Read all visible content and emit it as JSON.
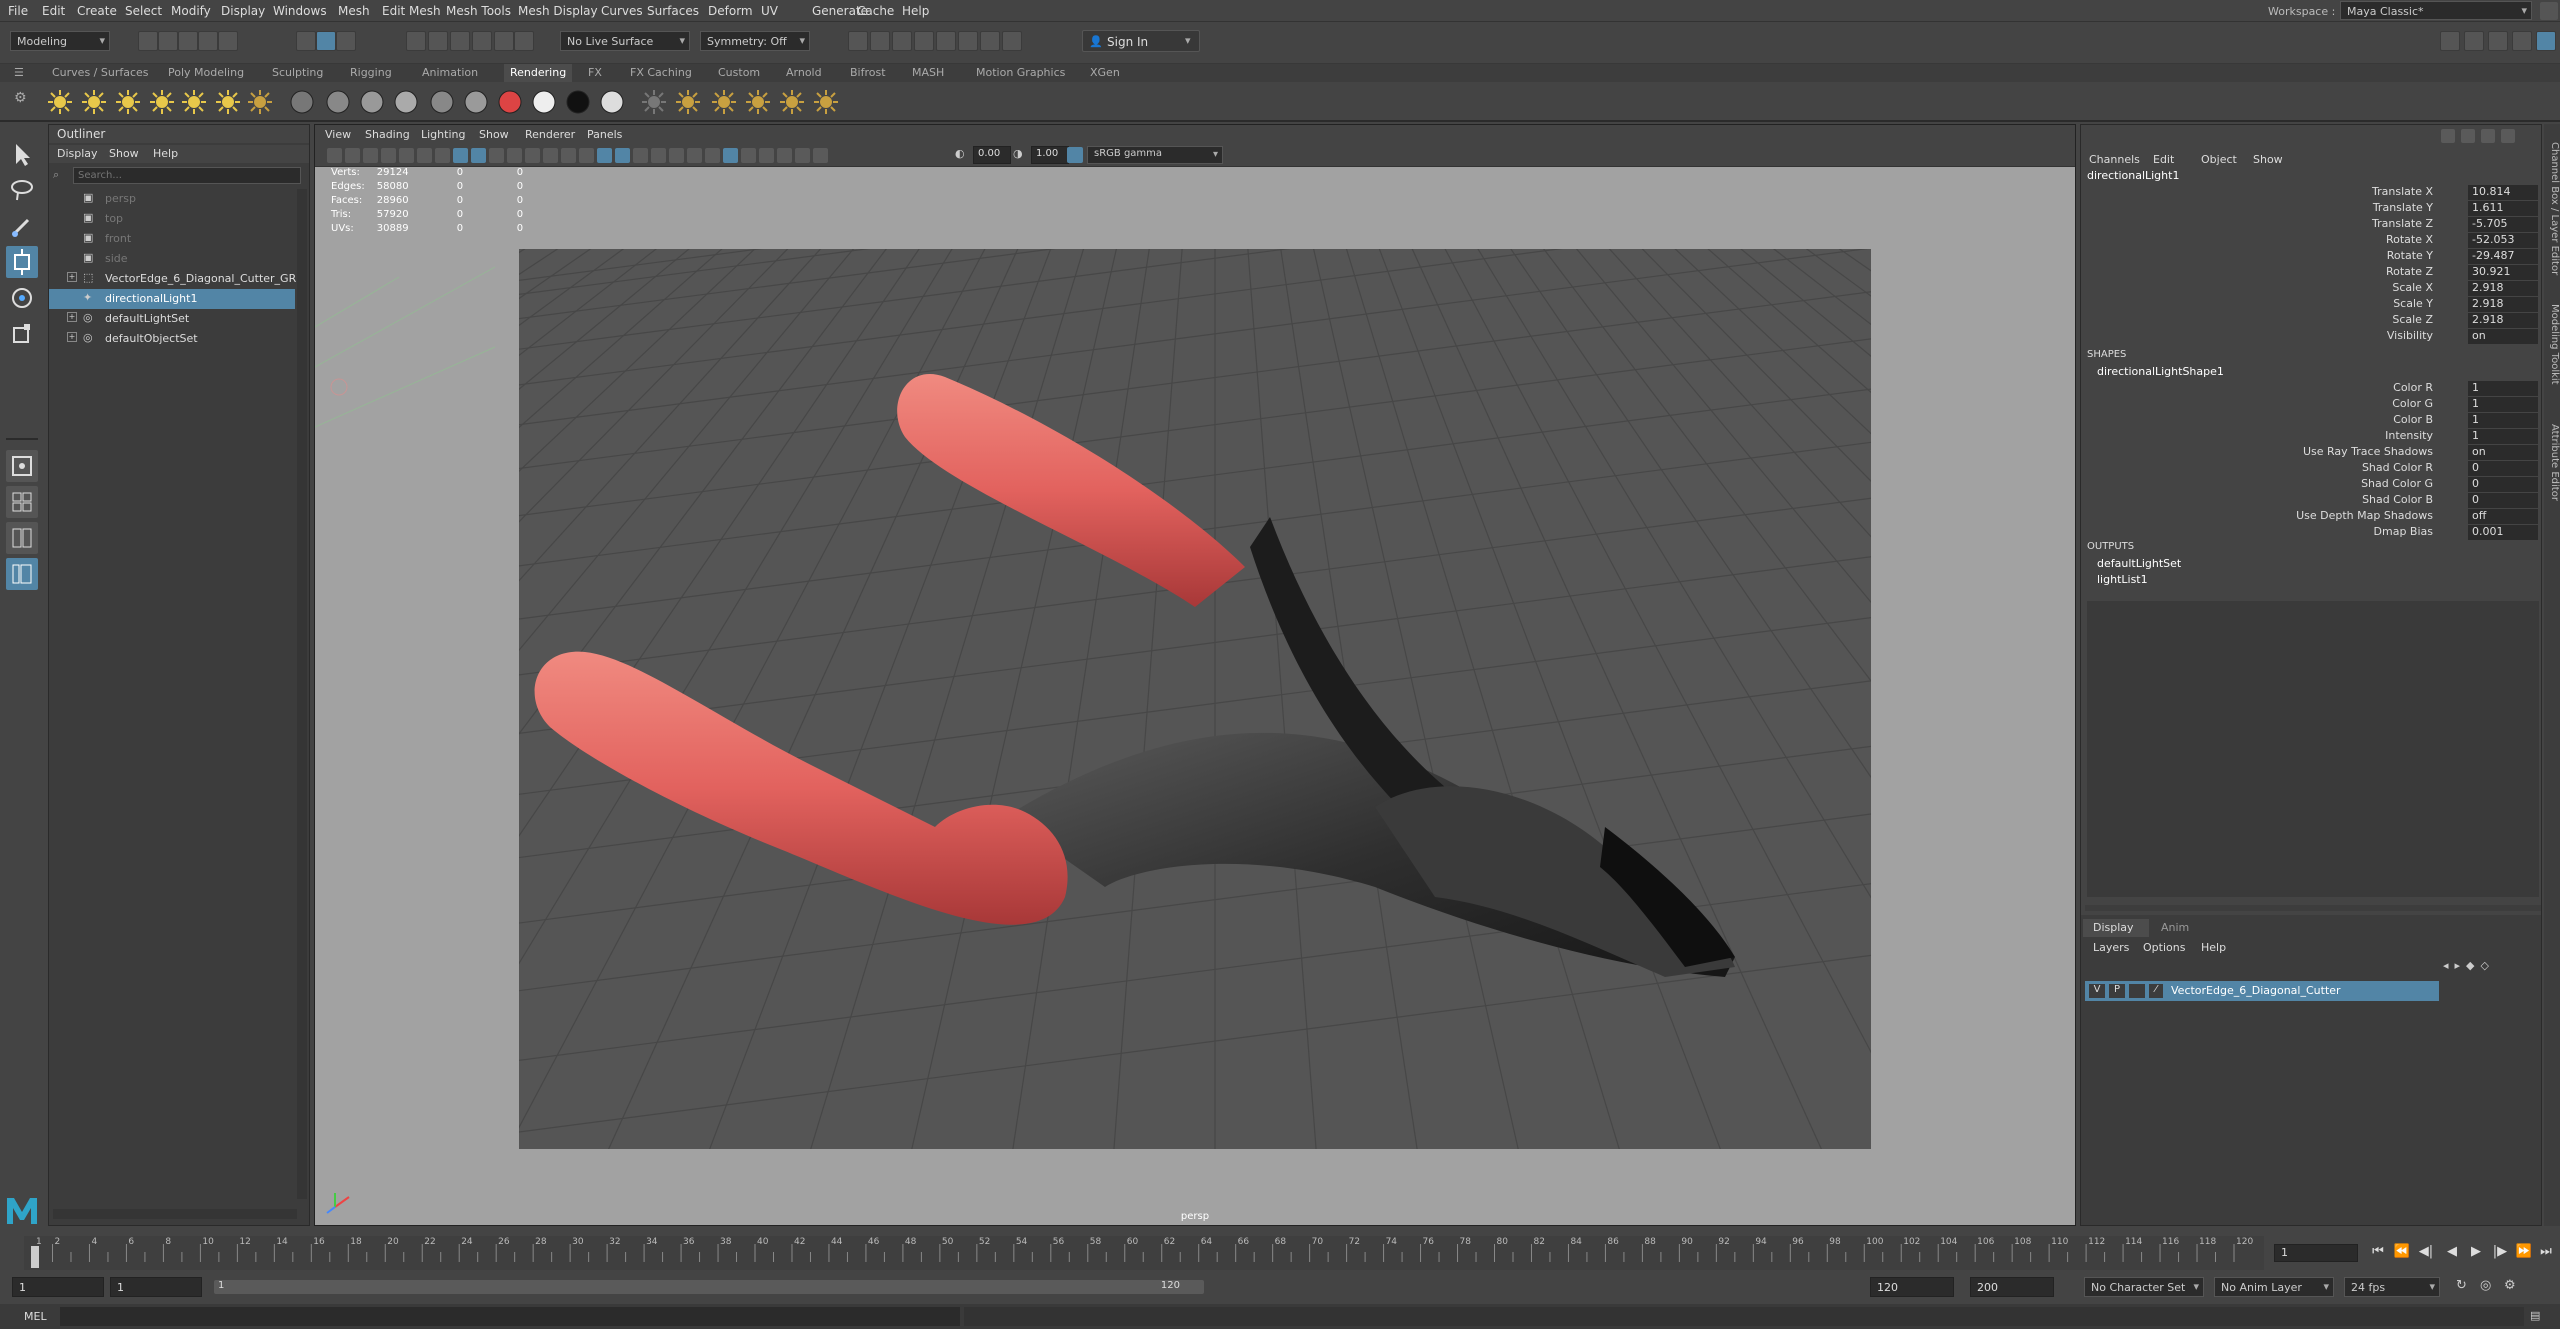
{
  "menubar": {
    "items": [
      "File",
      "Edit",
      "Create",
      "Select",
      "Modify",
      "Display",
      "Windows",
      "Mesh",
      "Edit Mesh",
      "Mesh Tools",
      "Mesh Display",
      "Curves",
      "Surfaces",
      "Deform",
      "UV",
      "Generate",
      "Cache",
      "Help"
    ],
    "workspace_label": "Workspace :",
    "workspace_value": "Maya Classic*"
  },
  "statusline": {
    "mode": "Modeling",
    "live_surface": "No Live Surface",
    "symmetry": "Symmetry: Off",
    "sign_in": "Sign In"
  },
  "shelf": {
    "tabs": [
      "Curves / Surfaces",
      "Poly Modeling",
      "Sculpting",
      "Rigging",
      "Animation",
      "Rendering",
      "FX",
      "FX Caching",
      "Custom",
      "Arnold",
      "Bifrost",
      "MASH",
      "Motion Graphics",
      "XGen"
    ],
    "active_tab": "Rendering"
  },
  "outliner": {
    "title": "Outliner",
    "menus": [
      "Display",
      "Show",
      "Help"
    ],
    "search_placeholder": "Search...",
    "items": [
      {
        "label": "persp",
        "icon": "camera-icon",
        "state": "dim"
      },
      {
        "label": "top",
        "icon": "camera-icon",
        "state": "dim"
      },
      {
        "label": "front",
        "icon": "camera-icon",
        "state": "dim"
      },
      {
        "label": "side",
        "icon": "camera-icon",
        "state": "dim"
      },
      {
        "label": "VectorEdge_6_Diagonal_Cutter_GRP",
        "icon": "group-icon",
        "state": "normal"
      },
      {
        "label": "directionalLight1",
        "icon": "directional-light-icon",
        "state": "selected"
      },
      {
        "label": "defaultLightSet",
        "icon": "set-icon",
        "state": "normal"
      },
      {
        "label": "defaultObjectSet",
        "icon": "set-icon",
        "state": "normal"
      }
    ]
  },
  "viewport": {
    "menus": [
      "View",
      "Shading",
      "Lighting",
      "Show",
      "Renderer",
      "Panels"
    ],
    "exposure": "0.00",
    "gamma": "1.00",
    "color_space": "sRGB gamma",
    "camera_label": "persp",
    "hud": [
      {
        "label": "Verts:",
        "a": "29124",
        "b": "0",
        "c": "0"
      },
      {
        "label": "Edges:",
        "a": "58080",
        "b": "0",
        "c": "0"
      },
      {
        "label": "Faces:",
        "a": "28960",
        "b": "0",
        "c": "0"
      },
      {
        "label": "Tris:",
        "a": "57920",
        "b": "0",
        "c": "0"
      },
      {
        "label": "UVs:",
        "a": "30889",
        "b": "0",
        "c": "0"
      }
    ]
  },
  "channelbox": {
    "menus": [
      "Channels",
      "Edit",
      "Object",
      "Show"
    ],
    "node": "directionalLight1",
    "channels": [
      {
        "name": "Translate X",
        "value": "10.814"
      },
      {
        "name": "Translate Y",
        "value": "1.611"
      },
      {
        "name": "Translate Z",
        "value": "-5.705"
      },
      {
        "name": "Rotate X",
        "value": "-52.053"
      },
      {
        "name": "Rotate Y",
        "value": "-29.487"
      },
      {
        "name": "Rotate Z",
        "value": "30.921"
      },
      {
        "name": "Scale X",
        "value": "2.918"
      },
      {
        "name": "Scale Y",
        "value": "2.918"
      },
      {
        "name": "Scale Z",
        "value": "2.918"
      },
      {
        "name": "Visibility",
        "value": "on"
      }
    ],
    "shapes_header": "SHAPES",
    "shape_node": "directionalLightShape1",
    "shape_channels": [
      {
        "name": "Color R",
        "value": "1"
      },
      {
        "name": "Color G",
        "value": "1"
      },
      {
        "name": "Color B",
        "value": "1"
      },
      {
        "name": "Intensity",
        "value": "1"
      },
      {
        "name": "Use Ray Trace Shadows",
        "value": "on"
      },
      {
        "name": "Shad Color R",
        "value": "0"
      },
      {
        "name": "Shad Color G",
        "value": "0"
      },
      {
        "name": "Shad Color B",
        "value": "0"
      },
      {
        "name": "Use Depth Map Shadows",
        "value": "off"
      },
      {
        "name": "Dmap Bias",
        "value": "0.001"
      }
    ],
    "outputs_header": "OUTPUTS",
    "outputs": [
      "defaultLightSet",
      "lightList1"
    ]
  },
  "layers": {
    "tabs": [
      "Display",
      "Anim"
    ],
    "menus": [
      "Layers",
      "Options",
      "Help"
    ],
    "layer_v": "V",
    "layer_p": "P",
    "layer_name": "VectorEdge_6_Diagonal_Cutter"
  },
  "sidetabs": [
    "Channel Box / Layer Editor",
    "Modeling Toolkit",
    "Attribute Editor"
  ],
  "timeline": {
    "ticks": [
      "1",
      "2",
      "4",
      "6",
      "8",
      "10",
      "12",
      "14",
      "16",
      "18",
      "20",
      "22",
      "24",
      "26",
      "28",
      "30",
      "32",
      "34",
      "36",
      "38",
      "40",
      "42",
      "44",
      "46",
      "48",
      "50",
      "52",
      "54",
      "56",
      "58",
      "60",
      "62",
      "64",
      "66",
      "68",
      "70",
      "72",
      "74",
      "76",
      "78",
      "80",
      "82",
      "84",
      "86",
      "88",
      "90",
      "92",
      "94",
      "96",
      "98",
      "100",
      "102",
      "104",
      "106",
      "108",
      "110",
      "112",
      "114",
      "116",
      "118",
      "120"
    ],
    "current_frame": "1"
  },
  "range": {
    "start": "1",
    "inner_start": "1",
    "slider_start": "1",
    "slider_end": "120",
    "anim_end": "120",
    "range_end": "200",
    "character_set": "No Character Set",
    "anim_layer": "No Anim Layer",
    "fps": "24 fps"
  },
  "cmdline": {
    "lang": "MEL"
  },
  "colors": {
    "selection": "#5285a6",
    "grip": "#e06060",
    "metal": "#2e2e2e"
  }
}
